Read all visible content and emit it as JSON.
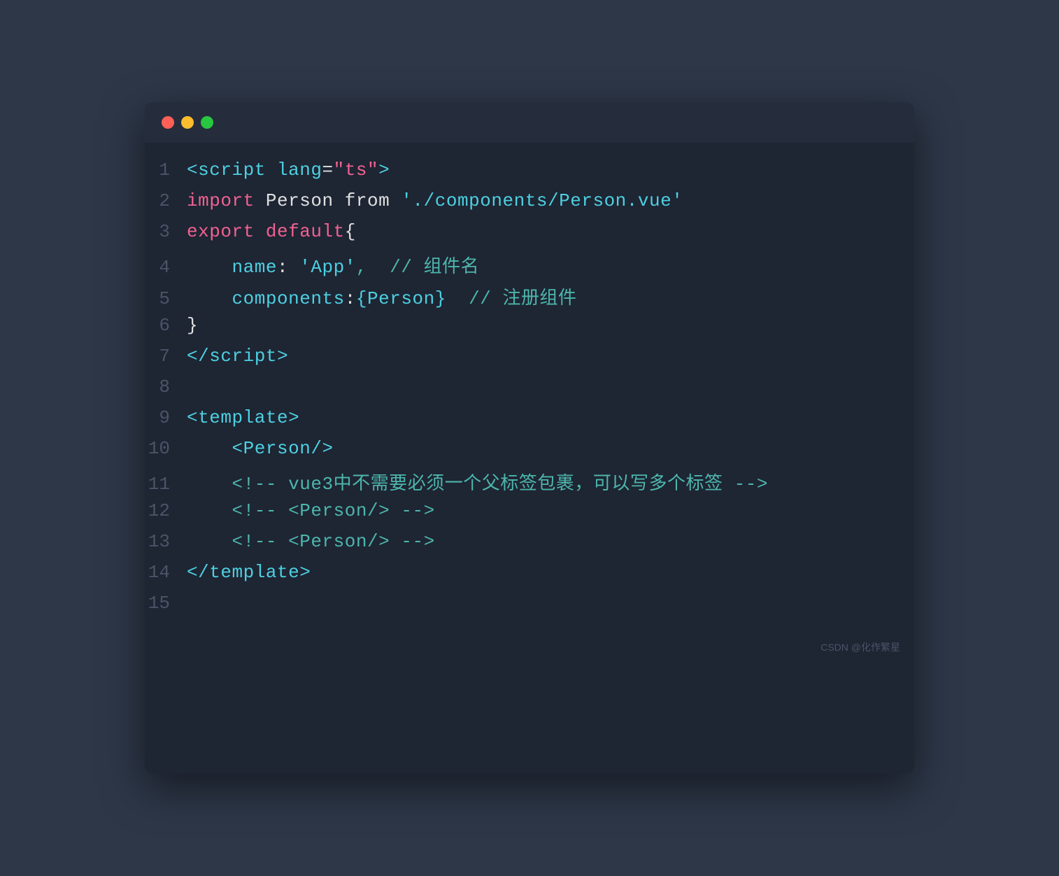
{
  "window": {
    "title": "Code Editor",
    "dots": [
      "red",
      "yellow",
      "green"
    ]
  },
  "watermark": "CSDN @化作繁星",
  "lines": [
    {
      "num": "1",
      "tokens": [
        {
          "text": "<",
          "class": "c-tag"
        },
        {
          "text": "script",
          "class": "c-tag"
        },
        {
          "text": " ",
          "class": ""
        },
        {
          "text": "lang",
          "class": "c-attr-name"
        },
        {
          "text": "=",
          "class": "c-white"
        },
        {
          "text": "\"ts\"",
          "class": "c-attr-val"
        },
        {
          "text": ">",
          "class": "c-tag"
        }
      ]
    },
    {
      "num": "2",
      "tokens": [
        {
          "text": "import",
          "class": "c-keyword"
        },
        {
          "text": " Person ",
          "class": "c-white"
        },
        {
          "text": "from",
          "class": "c-white"
        },
        {
          "text": " ",
          "class": ""
        },
        {
          "text": "'./components/Person.vue'",
          "class": "c-path"
        }
      ]
    },
    {
      "num": "3",
      "tokens": [
        {
          "text": "export",
          "class": "c-keyword"
        },
        {
          "text": " ",
          "class": ""
        },
        {
          "text": "default",
          "class": "c-keyword"
        },
        {
          "text": "{",
          "class": "c-brace"
        }
      ]
    },
    {
      "num": "4",
      "tokens": [
        {
          "text": "    ",
          "class": ""
        },
        {
          "text": "name",
          "class": "c-prop"
        },
        {
          "text": ": ",
          "class": "c-white"
        },
        {
          "text": "'App'",
          "class": "c-value"
        },
        {
          "text": ",  // ",
          "class": "c-comment"
        },
        {
          "text": "组件名",
          "class": "c-comment"
        }
      ]
    },
    {
      "num": "5",
      "tokens": [
        {
          "text": "    ",
          "class": ""
        },
        {
          "text": "components",
          "class": "c-prop"
        },
        {
          "text": ":",
          "class": "c-white"
        },
        {
          "text": "{Person}",
          "class": "c-value"
        },
        {
          "text": "  // ",
          "class": "c-comment"
        },
        {
          "text": "注册组件",
          "class": "c-comment"
        }
      ]
    },
    {
      "num": "6",
      "tokens": [
        {
          "text": "}",
          "class": "c-brace"
        }
      ]
    },
    {
      "num": "7",
      "tokens": [
        {
          "text": "<",
          "class": "c-tag"
        },
        {
          "text": "/script",
          "class": "c-tag"
        },
        {
          "text": ">",
          "class": "c-tag"
        }
      ]
    },
    {
      "num": "8",
      "tokens": []
    },
    {
      "num": "9",
      "tokens": [
        {
          "text": "<",
          "class": "c-tag"
        },
        {
          "text": "template",
          "class": "c-tag"
        },
        {
          "text": ">",
          "class": "c-tag"
        }
      ]
    },
    {
      "num": "10",
      "tokens": [
        {
          "text": "    ",
          "class": ""
        },
        {
          "text": "<",
          "class": "c-tag"
        },
        {
          "text": "Person",
          "class": "c-tag"
        },
        {
          "text": "/>",
          "class": "c-tag"
        }
      ]
    },
    {
      "num": "11",
      "tokens": [
        {
          "text": "    ",
          "class": ""
        },
        {
          "text": "<!-- ",
          "class": "c-comment"
        },
        {
          "text": "vue3中不需要必须一个父标签包裹，可以写多个标签",
          "class": "c-comment"
        },
        {
          "text": " -->",
          "class": "c-comment"
        }
      ]
    },
    {
      "num": "12",
      "tokens": [
        {
          "text": "    ",
          "class": ""
        },
        {
          "text": "<!-- ",
          "class": "c-comment"
        },
        {
          "text": "<Person/>",
          "class": "c-comment"
        },
        {
          "text": " -->",
          "class": "c-comment"
        }
      ]
    },
    {
      "num": "13",
      "tokens": [
        {
          "text": "    ",
          "class": ""
        },
        {
          "text": "<!-- ",
          "class": "c-comment"
        },
        {
          "text": "<Person/>",
          "class": "c-comment"
        },
        {
          "text": " -->",
          "class": "c-comment"
        }
      ]
    },
    {
      "num": "14",
      "tokens": [
        {
          "text": "<",
          "class": "c-tag"
        },
        {
          "text": "/template",
          "class": "c-tag"
        },
        {
          "text": ">",
          "class": "c-tag"
        }
      ]
    },
    {
      "num": "15",
      "tokens": []
    }
  ]
}
